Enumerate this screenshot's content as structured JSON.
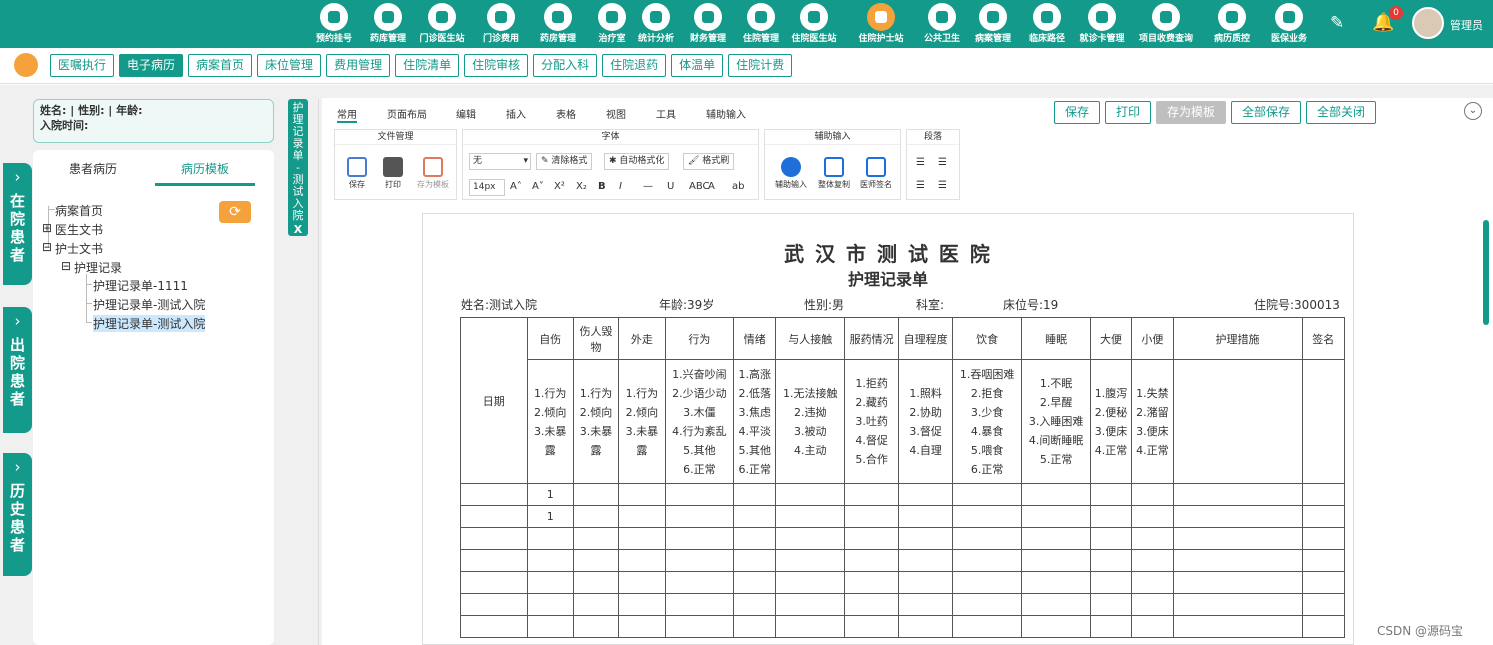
{
  "topnav": [
    {
      "label": "预约挂号",
      "icon": "calendar-icon"
    },
    {
      "label": "药库管理",
      "icon": "warehouse-icon"
    },
    {
      "label": "门诊医生站",
      "icon": "doctor-icon"
    },
    {
      "label": "门诊费用",
      "icon": "yuan-icon"
    },
    {
      "label": "药房管理",
      "icon": "pill-icon"
    },
    {
      "label": "治疗室",
      "icon": "treatment-icon"
    },
    {
      "label": "统计分析",
      "icon": "chart-icon"
    },
    {
      "label": "财务管理",
      "icon": "gear-icon"
    },
    {
      "label": "住院管理",
      "icon": "bed-icon"
    },
    {
      "label": "住院医生站",
      "icon": "inpatient-doctor-icon"
    },
    {
      "label": "住院护士站",
      "icon": "nurse-icon"
    },
    {
      "label": "公共卫生",
      "icon": "public-health-icon"
    },
    {
      "label": "病案管理",
      "icon": "record-icon"
    },
    {
      "label": "临床路径",
      "icon": "path-icon"
    },
    {
      "label": "就诊卡管理",
      "icon": "card-icon"
    },
    {
      "label": "项目收费查询",
      "icon": "query-icon"
    },
    {
      "label": "病历质控",
      "icon": "quality-icon"
    },
    {
      "label": "医保业务",
      "icon": "insurance-icon"
    }
  ],
  "notifications": {
    "count": "0"
  },
  "user": {
    "name": "管理员"
  },
  "tabs": [
    "医嘱执行",
    "电子病历",
    "病案首页",
    "床位管理",
    "费用管理",
    "住院清单",
    "住院审核",
    "分配入科",
    "住院退药",
    "体温单",
    "住院计费"
  ],
  "side_tabs": [
    "在院患者",
    "出院患者",
    "历史患者"
  ],
  "patient": {
    "line1": "姓名:   | 性别:   | 年龄:",
    "line2": "入院时间:"
  },
  "tree": {
    "tabs": [
      "患者病历",
      "病历模板"
    ],
    "nodes": [
      "病案首页",
      "医生文书",
      "护士文书",
      "护理记录",
      "护理记录单-1111",
      "护理记录单-测试入院",
      "护理记录单-测试入院"
    ],
    "expanders": [
      "⊞",
      "⊟",
      "⊟"
    ]
  },
  "doc_tab": {
    "label": "护理记录单-测试入院",
    "close": "X"
  },
  "ribbon": {
    "tabs": [
      "常用",
      "页面布局",
      "编辑",
      "插入",
      "表格",
      "视图",
      "工具",
      "辅助输入"
    ],
    "actions": [
      "保存",
      "打印",
      "存为模板",
      "全部保存",
      "全部关闭"
    ],
    "groups": {
      "file": {
        "title": "文件管理",
        "buttons": [
          "保存",
          "打印",
          "存为模板"
        ]
      },
      "font": {
        "title": "字体",
        "font_name": "无",
        "font_size": "14px",
        "buttons": [
          "清除格式",
          "自动格式化",
          "格式刷"
        ],
        "icons": [
          "A˄",
          "A˅",
          "X²",
          "X₂",
          "B",
          "I",
          "—",
          "U",
          "ABC",
          "A",
          "ab"
        ]
      },
      "assist": {
        "title": "辅助输入",
        "buttons": [
          "辅助输入",
          "整体复制",
          "医师签名"
        ]
      },
      "para": {
        "title": "段落"
      }
    }
  },
  "document": {
    "hospital": "武 汉 市 测 试 医 院",
    "title": "护理记录单",
    "patient_fields": [
      {
        "label": "姓名:",
        "value": "测试入院"
      },
      {
        "label": "年龄:",
        "value": "39岁"
      },
      {
        "label": "性别:",
        "value": "男"
      },
      {
        "label": "科室:",
        "value": ""
      },
      {
        "label": "床位号:",
        "value": "19"
      },
      {
        "label": "住院号:",
        "value": "300013"
      }
    ],
    "table": {
      "date_header": "日期",
      "columns": [
        {
          "header": "自伤",
          "options": "1.行为\n2.倾向\n3.未暴\n露"
        },
        {
          "header": "伤人毁\n物",
          "options": "1.行为\n2.倾向\n3.未暴\n露"
        },
        {
          "header": "外走",
          "options": "1.行为\n2.倾向\n3.未暴\n露"
        },
        {
          "header": "行为",
          "options": "1.兴奋吵闹\n2.少语少动\n3.木僵\n4.行为紊乱\n5.其他\n6.正常"
        },
        {
          "header": "情绪",
          "options": "1.高涨\n2.低落\n3.焦虑\n4.平淡\n5.其他\n6.正常"
        },
        {
          "header": "与人接触",
          "options": "1.无法接触\n2.违拗\n3.被动\n4.主动"
        },
        {
          "header": "服药情况",
          "options": "1.拒药\n2.藏药\n3.吐药\n4.督促\n5.合作"
        },
        {
          "header": "自理程度",
          "options": "1.照料\n2.协助\n3.督促\n4.自理"
        },
        {
          "header": "饮食",
          "options": "1.吞咽困难\n2.拒食\n3.少食\n4.暴食\n5.喂食\n6.正常"
        },
        {
          "header": "睡眠",
          "options": "1.不眠\n2.早醒\n3.入睡困难\n4.间断睡眠\n5.正常"
        },
        {
          "header": "大便",
          "options": "1.腹泻\n2.便秘\n3.便床\n4.正常"
        },
        {
          "header": "小便",
          "options": "1.失禁\n2.潴留\n3.便床\n4.正常"
        },
        {
          "header": "护理措施",
          "options": ""
        },
        {
          "header": "签名",
          "options": ""
        }
      ],
      "rows": [
        [
          "",
          "1",
          "",
          "",
          "",
          "",
          "",
          "",
          "",
          "",
          "",
          "",
          "",
          "",
          ""
        ],
        [
          "",
          "1",
          "",
          "",
          "",
          "",
          "",
          "",
          "",
          "",
          "",
          "",
          "",
          "",
          ""
        ],
        [
          "",
          "",
          "",
          "",
          "",
          "",
          "",
          "",
          "",
          "",
          "",
          "",
          "",
          "",
          ""
        ],
        [
          "",
          "",
          "",
          "",
          "",
          "",
          "",
          "",
          "",
          "",
          "",
          "",
          "",
          "",
          ""
        ],
        [
          "",
          "",
          "",
          "",
          "",
          "",
          "",
          "",
          "",
          "",
          "",
          "",
          "",
          "",
          ""
        ],
        [
          "",
          "",
          "",
          "",
          "",
          "",
          "",
          "",
          "",
          "",
          "",
          "",
          "",
          "",
          ""
        ],
        [
          "",
          "",
          "",
          "",
          "",
          "",
          "",
          "",
          "",
          "",
          "",
          "",
          "",
          "",
          ""
        ]
      ]
    }
  },
  "watermark": "CSDN @源码宝",
  "colors": {
    "primary": "#139a8a",
    "accent": "#f6a23c",
    "badge": "#e53935"
  }
}
